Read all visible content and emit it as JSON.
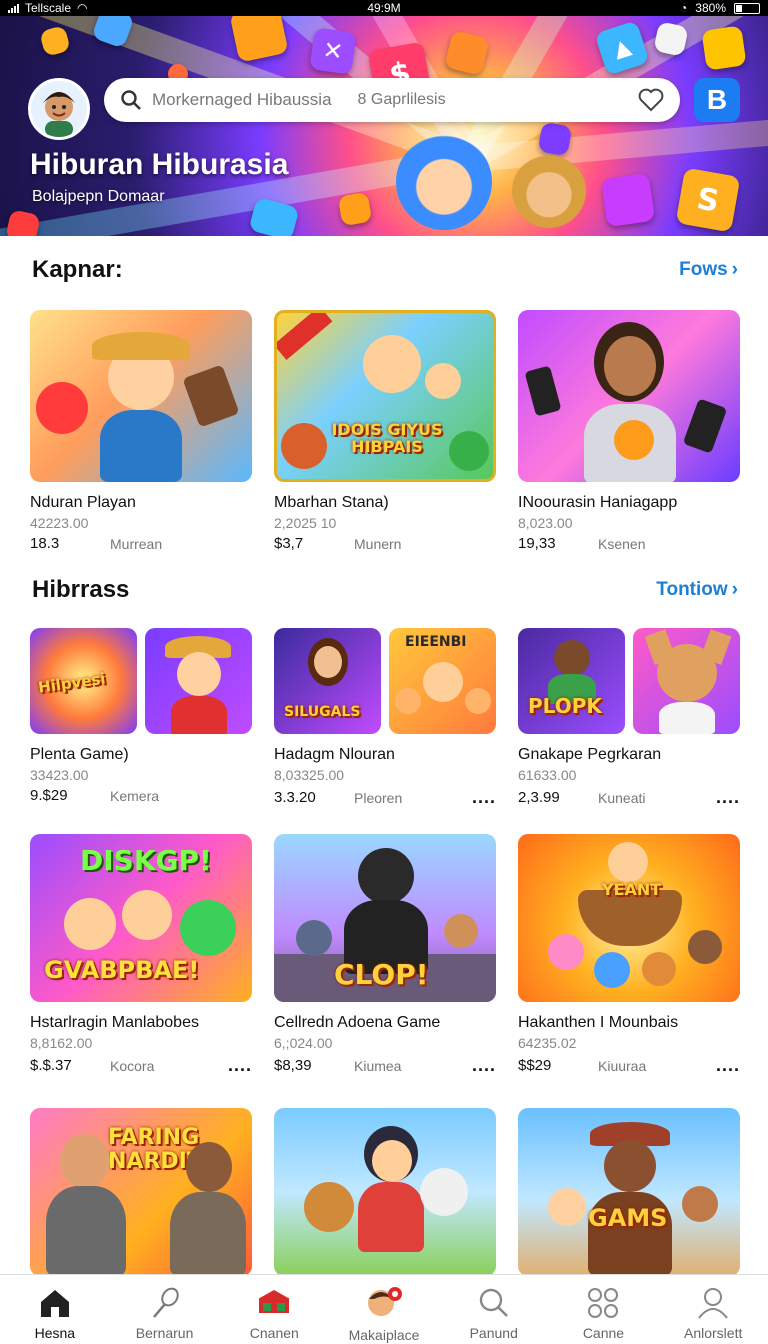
{
  "status": {
    "carrier": "Tellscale",
    "time": "49:9M",
    "battery": "380%"
  },
  "hero": {
    "search_placeholder": "Morkernaged Hibaussia",
    "search_secondary": "8 Gaprlilesis",
    "button_letter": "B",
    "title": "Hiburan Hiburasia",
    "subtitle": "Bolajpepn Domaar"
  },
  "sections": [
    {
      "title": "Kapnar:",
      "more": "Fows",
      "cards": [
        {
          "name": "Nduran Playan",
          "sub": "42223.00",
          "price": "18.3",
          "tag": "Murrean"
        },
        {
          "name": "Mbarhan Stana)",
          "sub": "2,2025 10",
          "price": "$3,7",
          "tag": "Munern",
          "art_text": "IDOIS GIYUS HIBPAIS"
        },
        {
          "name": "INoourasin Haniagapp",
          "sub": "8,023.00",
          "price": "19,33",
          "tag": "Ksenen"
        }
      ]
    },
    {
      "title": "Hibrrass",
      "more": "Tontiow",
      "cards": [
        {
          "name": "Plenta Game)",
          "sub": "33423.00",
          "price": "9.$29",
          "tag": "Kemera",
          "art_text": "Hilpvesi"
        },
        {
          "name": "Hadagm Nlouran",
          "sub": "8,03325.00",
          "price": "3.3.20",
          "tag": "Pleoren",
          "dots": "....",
          "art_text": "SILUGALS",
          "art_text2": "EIEENBI"
        },
        {
          "name": "Gnakape Pegrkaran",
          "sub": "61633.00",
          "price": "2,3.99",
          "tag": "Kuneati",
          "dots": "....",
          "art_text": "PLOPK"
        }
      ]
    },
    {
      "cards": [
        {
          "name": "Hstarlragin Manlabobes",
          "sub": "8,8162.00",
          "price": "$.$.37",
          "tag": "Kocora",
          "dots": "....",
          "art_text": "DISKGP!",
          "art_text2": "GVABPBAE!"
        },
        {
          "name": "Cellredn Adoena Game",
          "sub": "6,;024.00",
          "price": "$8,39",
          "tag": "Kiumea",
          "dots": "....",
          "art_text": "CLOP!"
        },
        {
          "name": "Hakanthen I Mounbais",
          "sub": "64235.02",
          "price": "$$29",
          "tag": "Kiuuraa",
          "dots": "....",
          "art_text": "YEANT"
        }
      ]
    },
    {
      "cards": [
        {
          "art_text": "FARING NARDIT!"
        },
        {},
        {
          "art_text": "GAMS"
        }
      ]
    }
  ],
  "nav": [
    {
      "label": "Hesna",
      "icon": "home-icon"
    },
    {
      "label": "Bernarun",
      "icon": "pen-icon"
    },
    {
      "label": "Cnanen",
      "icon": "store-icon"
    },
    {
      "label": "Makaiplace",
      "icon": "avatar-icon"
    },
    {
      "label": "Panund",
      "icon": "search-icon"
    },
    {
      "label": "Canne",
      "icon": "grid-icon"
    },
    {
      "label": "Anlorslett",
      "icon": "profile-icon"
    }
  ],
  "colors": {
    "accent": "#1e7fd6",
    "button": "#1c7cf2"
  }
}
